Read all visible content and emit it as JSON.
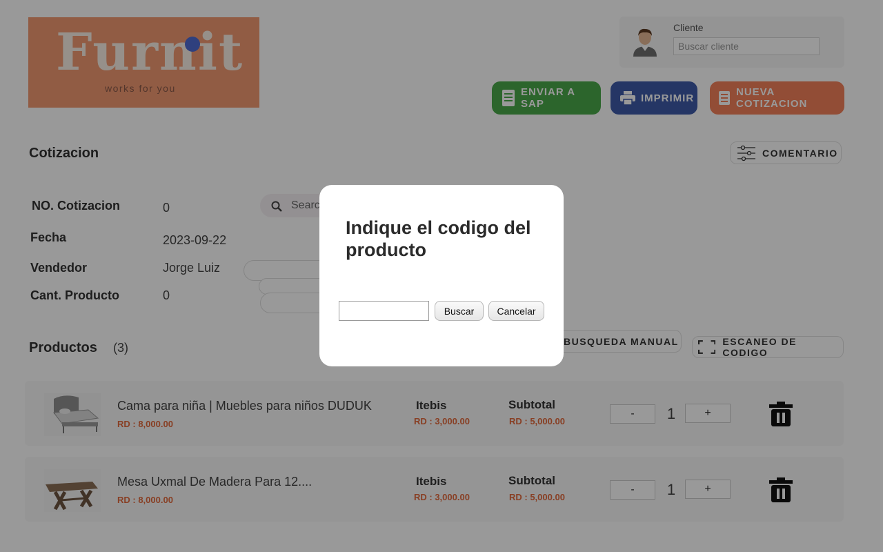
{
  "logo": {
    "word": "Furnit",
    "tagline": "works for you"
  },
  "client": {
    "label": "Cliente",
    "placeholder": "Buscar cliente",
    "value": ""
  },
  "actions": {
    "send_sap": "ENVIAR A SAP",
    "print": "IMPRIMIR",
    "new_quote": "NUEVA COTIZACION"
  },
  "quote": {
    "title": "Cotizacion",
    "comment_button": "COMENTARIO",
    "fields": [
      {
        "label": "NO. Cotizacion",
        "value": "0"
      },
      {
        "label": "Fecha",
        "value": "2023-09-22"
      },
      {
        "label": "Vendedor",
        "value": "Jorge Luiz"
      },
      {
        "label": "Cant. Producto",
        "value": "0"
      }
    ],
    "search_text": "Search"
  },
  "products": {
    "title": "Productos",
    "count": "(3)",
    "manual_search": "BUSQUEDA MANUAL",
    "scan_code": "ESCANEO DE CODIGO",
    "items": [
      {
        "name": "Cama para niña | Muebles para niños DUDUK",
        "price": "RD : 8,000.00",
        "itebis_label": "Itebis",
        "itebis": "RD : 3,000.00",
        "subtotal_label": "Subtotal",
        "subtotal": "RD : 5,000.00",
        "minus": "-",
        "qty": "1",
        "plus": "+"
      },
      {
        "name": "Mesa Uxmal De Madera Para 12....",
        "price": "RD : 8,000.00",
        "itebis_label": "Itebis",
        "itebis": "RD : 3,000.00",
        "subtotal_label": "Subtotal",
        "subtotal": "RD : 5,000.00",
        "minus": "-",
        "qty": "1",
        "plus": "+"
      }
    ]
  },
  "dialog": {
    "title": "Indique el codigo del producto",
    "input_value": "",
    "search_button": "Buscar",
    "cancel_button": "Cancelar"
  },
  "colors": {
    "brand_orange": "#f29a72",
    "sap_green": "#4aa84a",
    "print_blue": "#3f5ba8",
    "new_orange": "#f4805a",
    "price_orange": "#e36a3d"
  }
}
